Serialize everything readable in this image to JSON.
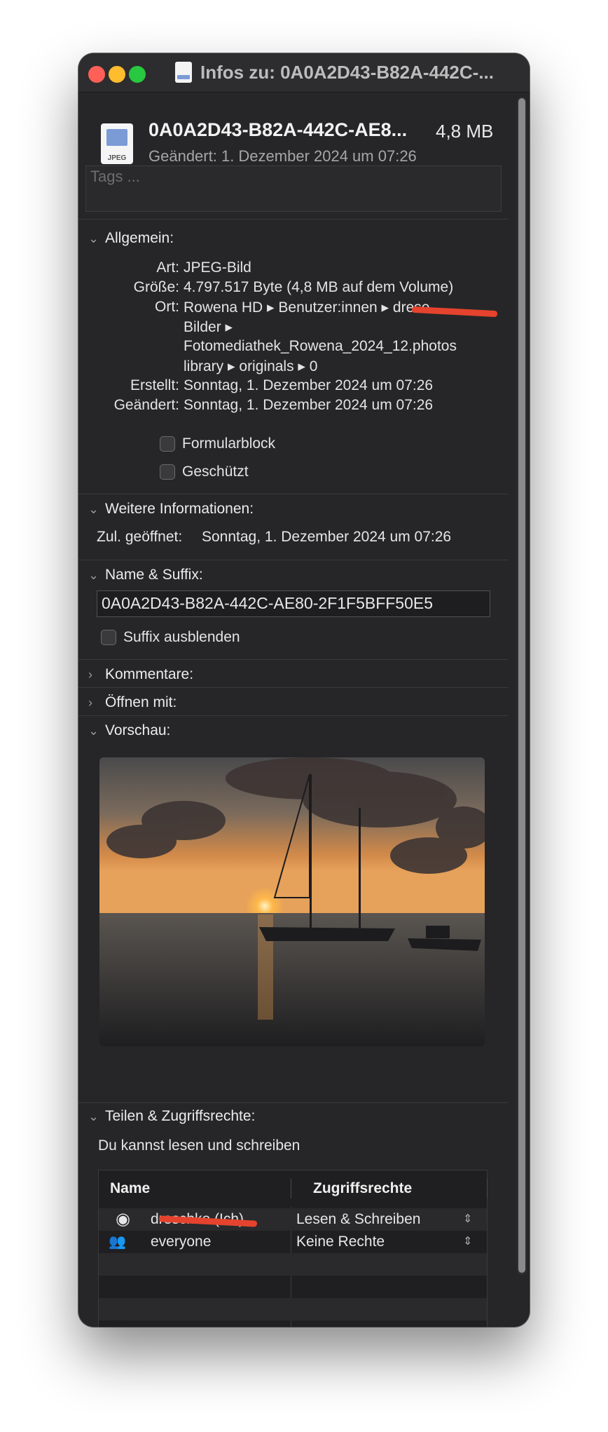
{
  "window": {
    "title": "Infos zu: 0A0A2D43-B82A-442C-...",
    "icon": "jpeg-file-icon"
  },
  "header": {
    "file_name": "0A0A2D43-B82A-442C-AE8...",
    "file_size": "4,8 MB",
    "modified": "Geändert: 1. Dezember 2024 um 07:26",
    "file_icon_label": "JPEG"
  },
  "tags": {
    "placeholder": "Tags ..."
  },
  "general": {
    "heading": "Allgemein:",
    "kind_label": "Art:",
    "kind": "JPEG-Bild",
    "size_label": "Größe:",
    "size": "4.797.517 Byte (4,8 MB auf dem Volume)",
    "where_label": "Ort:",
    "where_lines": [
      "Rowena HD ▸ Benutzer:innen ▸ drese...",
      "Bilder ▸",
      "Fotomediathek_Rowena_2024_12.photos",
      "library ▸ originals ▸ 0"
    ],
    "created_label": "Erstellt:",
    "created": "Sonntag, 1. Dezember 2024 um 07:26",
    "modified_label": "Geändert:",
    "modified": "Sonntag, 1. Dezember 2024 um 07:26",
    "stationery": "Formularblock",
    "locked": "Geschützt"
  },
  "more_info": {
    "heading": "Weitere Informationen:",
    "last_opened_label": "Zul. geöffnet:",
    "last_opened": "Sonntag, 1. Dezember 2024 um 07:26"
  },
  "name_ext": {
    "heading": "Name & Suffix:",
    "name": "0A0A2D43-B82A-442C-AE80-2F1F5BFF50E5",
    "hide_ext": "Suffix ausblenden"
  },
  "comments": {
    "heading": "Kommentare:"
  },
  "open_with": {
    "heading": "Öffnen mit:"
  },
  "preview": {
    "heading": "Vorschau:"
  },
  "sharing": {
    "heading": "Teilen & Zugriffsrechte:",
    "summary": "Du kannst lesen und schreiben",
    "col_name": "Name",
    "col_privilege": "Zugriffsrechte",
    "rows": [
      {
        "name": "dreschke (Ich)",
        "privilege": "Lesen & Schreiben",
        "icon": "user-icon"
      },
      {
        "name": "everyone",
        "privilege": "Keine Rechte",
        "icon": "group-icon"
      }
    ]
  },
  "toolbar": {
    "add": "+",
    "remove": "−",
    "action": "⋯",
    "lock": "lock-icon"
  },
  "colors": {
    "accent_redaction": "#e5432d",
    "lock": "#e7a63c"
  }
}
